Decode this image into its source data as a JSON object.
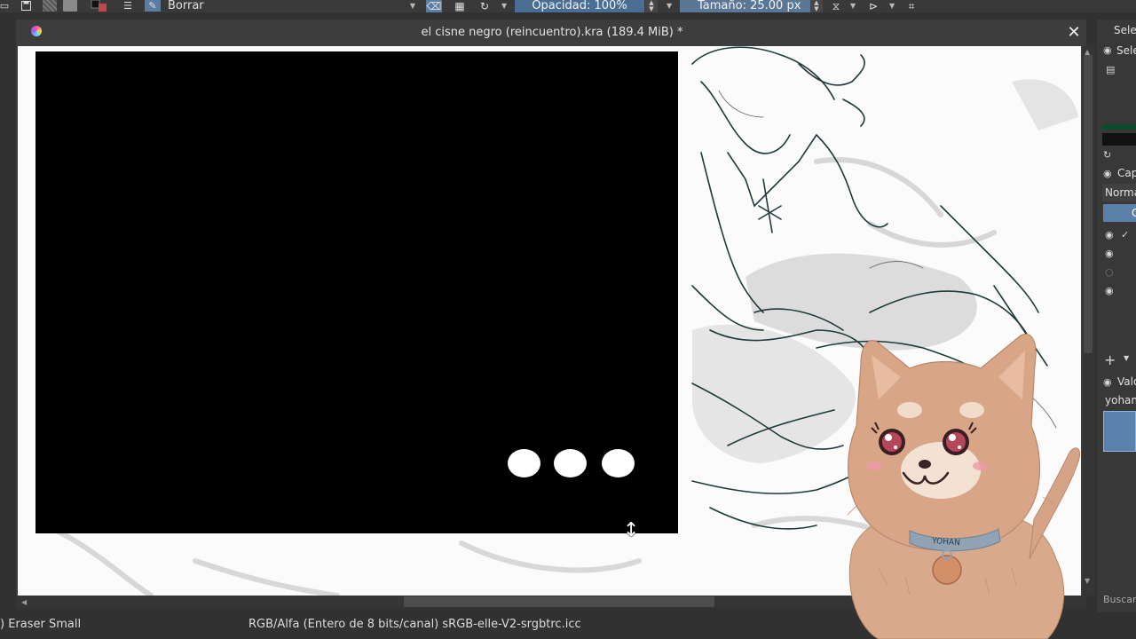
{
  "toolbar": {
    "brush_preset": "Borrar",
    "opacity": "Opacidad: 100%",
    "size": "Tamaño: 25.00 px"
  },
  "document": {
    "title": "el cisne negro (reincuentro).kra (189.4 MiB) *"
  },
  "status": {
    "brush_name": ") Eraser Small",
    "color_space": "RGB/Alfa (Entero de 8 bits/canal)  sRGB-elle-V2-srgbtrc.icc"
  },
  "dock": {
    "selection_header": "Sele",
    "selection_item": "Sele",
    "layers_header": "Cap",
    "blend_mode": "Norma",
    "blend_button": "C",
    "presets_header": "Valo",
    "presets_tag": "yohan",
    "search_label": "Buscar"
  },
  "avatar": {
    "collar_tag": "YOHAN"
  },
  "colors": {
    "accent": "#4a6e93",
    "overlay": "#000000",
    "canvas": "#fbfbfb"
  }
}
